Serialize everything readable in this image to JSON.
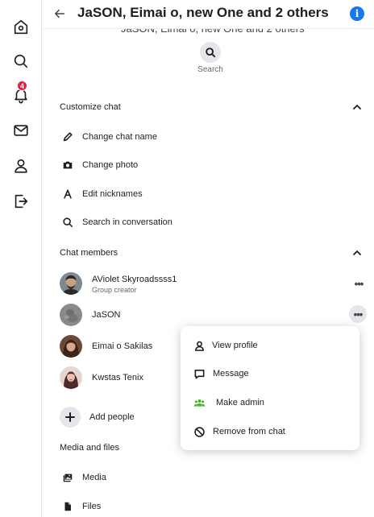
{
  "left_nav": {
    "items": [
      {
        "icon": "home-icon"
      },
      {
        "icon": "search-icon"
      },
      {
        "icon": "bell-icon",
        "badge": "4"
      },
      {
        "icon": "mail-icon"
      },
      {
        "icon": "person-icon"
      },
      {
        "icon": "logout-icon"
      }
    ]
  },
  "header": {
    "back_icon": "arrow-left-icon",
    "title": "JaSON, Eimai o, new One and 2 others",
    "info_icon": "info-icon",
    "info_glyph": "i"
  },
  "subtitle": "JaSON, Eimai o, new One and 2 others",
  "search": {
    "label": "Search"
  },
  "customize": {
    "header": "Customize chat",
    "items": [
      {
        "icon": "pencil-icon",
        "label": "Change chat name"
      },
      {
        "icon": "camera-icon",
        "label": "Change photo"
      },
      {
        "icon": "letter-a-icon",
        "label": "Edit nicknames"
      },
      {
        "icon": "search-icon",
        "label": "Search in conversation"
      }
    ]
  },
  "members": {
    "header": "Chat members",
    "list": [
      {
        "name": "AViolet Skyroadssss1",
        "role": "Group creator"
      },
      {
        "name": "JaSON",
        "role": ""
      },
      {
        "name": "Eimai o Sakilas",
        "role": ""
      },
      {
        "name": "Kwstas Tenix",
        "role": ""
      }
    ],
    "more_glyph": "•••",
    "add_label": "Add people"
  },
  "member_menu": {
    "items": [
      {
        "icon": "person-icon",
        "label": "View profile"
      },
      {
        "icon": "message-icon",
        "label": "Message"
      },
      {
        "icon": "people-icon",
        "label": "Make admin"
      },
      {
        "icon": "block-icon",
        "label": "Remove from chat"
      }
    ]
  },
  "media": {
    "header": "Media and files",
    "items": [
      {
        "icon": "image-icon",
        "label": "Media"
      },
      {
        "icon": "file-icon",
        "label": "Files"
      }
    ]
  },
  "colors": {
    "accent": "#1877f2",
    "badge": "#e41e3f",
    "make_admin_icon": "#42b72a"
  }
}
